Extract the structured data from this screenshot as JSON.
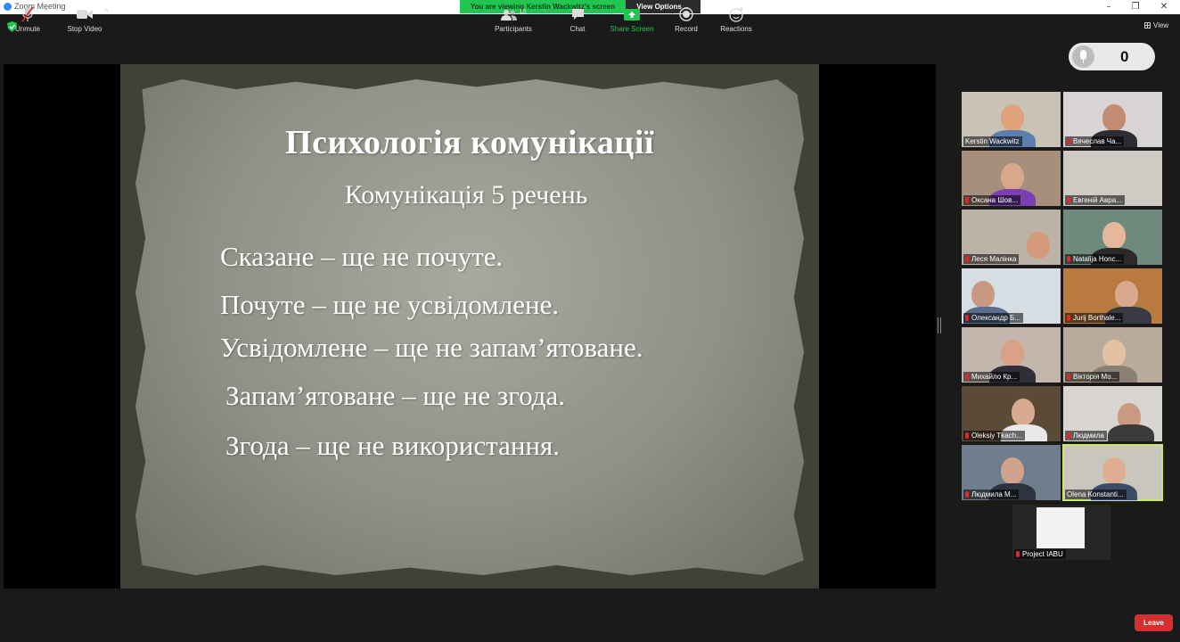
{
  "window": {
    "title": "Zoom Meeting",
    "controls": [
      "–",
      "❐",
      "✕"
    ]
  },
  "banner": {
    "viewing": "You are viewing Kerstin Wackwitz's screen",
    "view_options": "View Options ⌄"
  },
  "view_button": "View",
  "audience_counter": {
    "value": "0"
  },
  "slide": {
    "title": "Психологія комунікації",
    "subtitle": "Комунікація 5 речень",
    "lines": [
      "Сказане – ще не почуте.",
      "Почуте – ще не усвідомлене.",
      "Усвідомлене – ще не запам’ятоване.",
      "Запам’ятоване – ще не згода.",
      "Згода – ще не використання."
    ]
  },
  "participants_gallery": [
    {
      "name": "Kerstin Wackwitz",
      "muted": false
    },
    {
      "name": "Вячеслав Ча...",
      "muted": true
    },
    {
      "name": "Оксана Шов...",
      "muted": true
    },
    {
      "name": "Евгеній Авра...",
      "muted": true
    },
    {
      "name": "Леся Малінка",
      "muted": true
    },
    {
      "name": "Natalija Honc...",
      "muted": true
    },
    {
      "name": "Олександр Б...",
      "muted": true
    },
    {
      "name": "Jurij Borthale...",
      "muted": true
    },
    {
      "name": "Михайло Кр...",
      "muted": true
    },
    {
      "name": "Вікторія Мо...",
      "muted": true
    },
    {
      "name": "Oleksiy Tkach...",
      "muted": true
    },
    {
      "name": "Людмила",
      "muted": true
    },
    {
      "name": "Людмила М...",
      "muted": true
    },
    {
      "name": "Olena Konstanti...",
      "muted": false,
      "active_speaker": true
    },
    {
      "name": "Project IABU",
      "muted": true
    }
  ],
  "toolbar": {
    "unmute": "Unmute",
    "stop_video": "Stop Video",
    "participants": "Participants",
    "participants_count": "15",
    "chat": "Chat",
    "share_screen": "Share Screen",
    "record": "Record",
    "reactions": "Reactions",
    "leave": "Leave"
  },
  "colors": {
    "share_green": "#23c552",
    "leave_red": "#d32f2f",
    "active_speaker": "#c8e86a",
    "background": "#1a1a1a"
  }
}
